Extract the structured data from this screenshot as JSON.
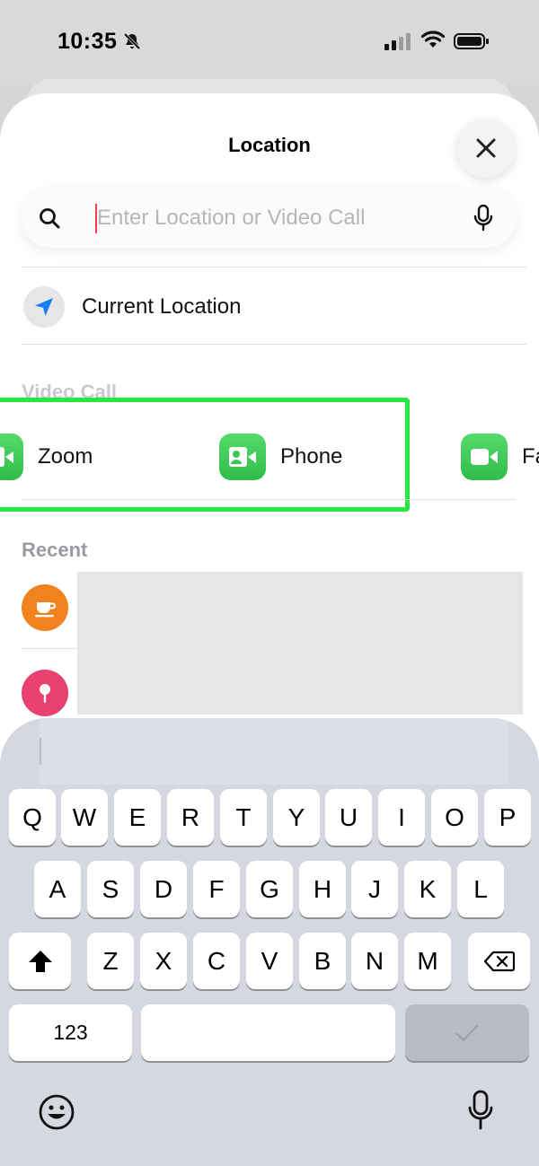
{
  "status_bar": {
    "time": "10:35"
  },
  "sheet": {
    "title": "Location",
    "close_icon": "close-icon",
    "search": {
      "placeholder": "Enter Location or Video Call",
      "value": ""
    },
    "current_location": {
      "label": "Current Location",
      "icon": "location-arrow-icon"
    },
    "video_call": {
      "section_label": "Video Call",
      "apps": [
        {
          "name": "Zoom",
          "icon": "video-call-app-icon"
        },
        {
          "name": "Phone",
          "icon": "video-call-app-icon"
        },
        {
          "name": "Fa",
          "icon": "facetime-icon"
        }
      ]
    },
    "recent": {
      "section_label": "Recent",
      "items": [
        {
          "icon": "cafe-icon",
          "color": "#f2821e"
        },
        {
          "icon": "pin-icon",
          "color": "#e8416f"
        }
      ]
    }
  },
  "keyboard": {
    "rows": [
      [
        "Q",
        "W",
        "E",
        "R",
        "T",
        "Y",
        "U",
        "I",
        "O",
        "P"
      ],
      [
        "A",
        "S",
        "D",
        "F",
        "G",
        "H",
        "J",
        "K",
        "L"
      ],
      [
        "Z",
        "X",
        "C",
        "V",
        "B",
        "N",
        "M"
      ]
    ],
    "numbers_label": "123"
  },
  "colors": {
    "highlight": "#27e63f",
    "caret": "#ff3b57",
    "app_green": "#34c759"
  }
}
